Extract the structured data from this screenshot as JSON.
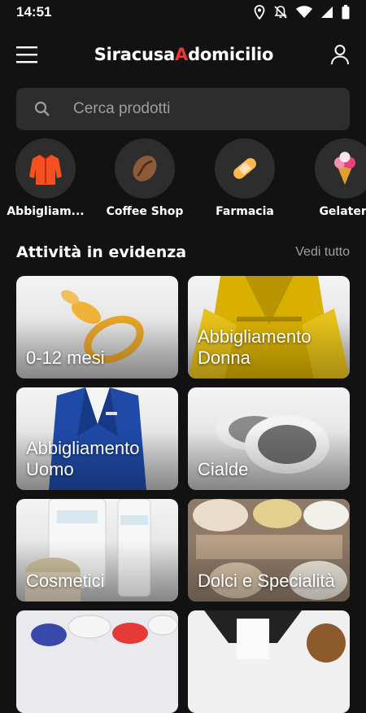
{
  "status_bar": {
    "time": "14:51"
  },
  "app_bar": {
    "logo_part1": "Siracusa",
    "logo_accent": "A",
    "logo_part2": "domicilio"
  },
  "search": {
    "placeholder": "Cerca prodotti"
  },
  "categories": [
    {
      "label": "Abbigliam..."
    },
    {
      "label": "Coffee Shop"
    },
    {
      "label": "Farmacia"
    },
    {
      "label": "Gelateri"
    }
  ],
  "featured": {
    "title": "Attività in evidenza",
    "see_all": "Vedi tutto",
    "cards": [
      {
        "title": "0-12 mesi"
      },
      {
        "title": "Abbigliamento Donna"
      },
      {
        "title": "Abbigliamento Uomo"
      },
      {
        "title": "Cialde"
      },
      {
        "title": "Cosmetici"
      },
      {
        "title": "Dolci e Specialità"
      },
      {
        "title": ""
      },
      {
        "title": ""
      }
    ]
  },
  "colors": {
    "background": "#121212",
    "surface": "#2d2d2d",
    "accent": "#e53935"
  }
}
